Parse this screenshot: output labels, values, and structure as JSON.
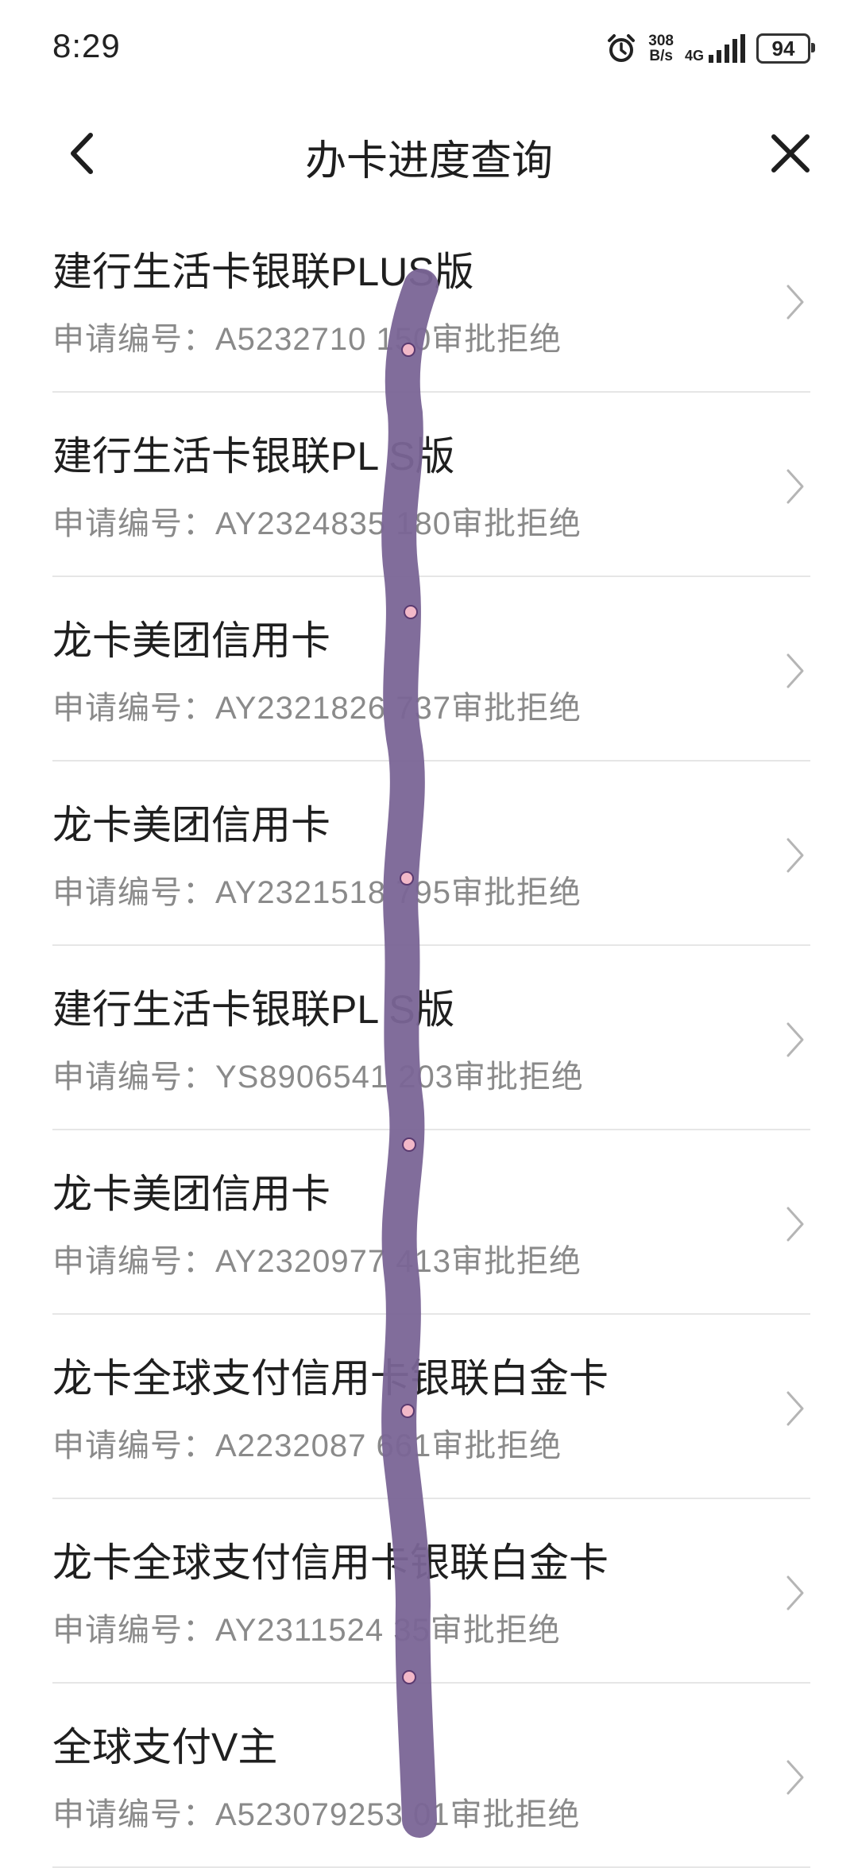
{
  "status_bar": {
    "time": "8:29",
    "net_speed_value": "308",
    "net_speed_unit": "B/s",
    "net_type": "4G",
    "battery": "94"
  },
  "nav": {
    "title": "办卡进度查询"
  },
  "items": [
    {
      "title": "建行生活卡银联PLUS版",
      "sub": "申请编号：A5232710  150审批拒绝"
    },
    {
      "title": "建行生活卡银联PL  S版",
      "sub": "申请编号：AY2324835  180审批拒绝"
    },
    {
      "title": "龙卡美团信用卡",
      "sub": "申请编号：AY2321826  737审批拒绝"
    },
    {
      "title": "龙卡美团信用卡",
      "sub": "申请编号：AY2321518  795审批拒绝"
    },
    {
      "title": "建行生活卡银联PL  S版",
      "sub": "申请编号：YS8906541  203审批拒绝"
    },
    {
      "title": "龙卡美团信用卡",
      "sub": "申请编号：AY2320977  413审批拒绝"
    },
    {
      "title": "龙卡全球支付信用卡银联白金卡",
      "sub": "申请编号：A2232087  661审批拒绝"
    },
    {
      "title": "龙卡全球支付信用卡银联白金卡",
      "sub": "申请编号：AY2311524  35审批拒绝"
    },
    {
      "title": "全球支付V主",
      "sub": "申请编号：A523079253  01审批拒绝"
    }
  ],
  "colors": {
    "scribble": "#7a6596",
    "divider": "#e6e6e6",
    "subtitle": "#8a8a8a"
  },
  "icons": [
    "alarm-icon",
    "signal-icon",
    "battery-icon",
    "back-arrow-icon",
    "close-icon",
    "chevron-right-icon"
  ]
}
